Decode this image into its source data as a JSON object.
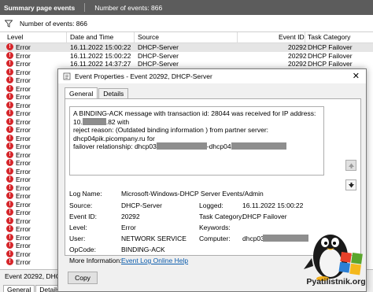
{
  "summary_bar": {
    "title": "Summary page events",
    "count": "Number of events: 866"
  },
  "filter_bar": {
    "icon": "filter-icon",
    "count": "Number of events: 866"
  },
  "columns": [
    "Level",
    "Date and Time",
    "Source",
    "Event ID",
    "Task Category"
  ],
  "first_rows": [
    {
      "level": "Error",
      "date": "16.11.2022 15:00:22",
      "source": "DHCP-Server",
      "event_id": "20292",
      "task": "DHCP Failover"
    },
    {
      "level": "Error",
      "date": "16.11.2022 15:00:22",
      "source": "DHCP-Server",
      "event_id": "20292",
      "task": "DHCP Failover"
    },
    {
      "level": "Error",
      "date": "16.11.2022 14:37:27",
      "source": "DHCP-Server",
      "event_id": "20292",
      "task": "DHCP Failover"
    }
  ],
  "error_label": "Error",
  "error_icon": "error-icon",
  "bottom_pane": {
    "title": "Event 20292, DHCP-",
    "tabs": [
      "General",
      "Details"
    ]
  },
  "dialog": {
    "title": "Event Properties - Event 20292, DHCP-Server",
    "close": "✕",
    "tabs": [
      "General",
      "Details"
    ],
    "message": {
      "line1_a": "A BINDING-ACK message with transaction id: 28044 was received for IP address: 10.",
      "line1_b": ".82 with",
      "line2": "reject reason:  (Outdated binding information ) from partner server: dhcp04pik.picompany.ru for",
      "line3_a": "failover relationship: dhcp03",
      "line3_b": "-dhcp04"
    },
    "fields": {
      "log_name_label": "Log Name:",
      "log_name": "Microsoft-Windows-DHCP Server Events/Admin",
      "source_label": "Source:",
      "source": "DHCP-Server",
      "logged_label": "Logged:",
      "logged": "16.11.2022 15:00:22",
      "event_id_label": "Event ID:",
      "event_id": "20292",
      "task_label": "Task Category:",
      "task": "DHCP Failover",
      "level_label": "Level:",
      "level": "Error",
      "keywords_label": "Keywords:",
      "keywords": "",
      "user_label": "User:",
      "user": "NETWORK SERVICE",
      "computer_label": "Computer:",
      "computer": "dhcp03",
      "opcode_label": "OpCode:",
      "opcode": "BINDING-ACK",
      "more_info_label": "More Information:",
      "more_info_link": "Event Log Online Help"
    },
    "copy_button": "Copy"
  },
  "watermark": "Pyatilistnik.org",
  "colors": {
    "title_bar": "#5c5c5c",
    "error_red": "#d6262b",
    "link": "#0b5cad"
  }
}
